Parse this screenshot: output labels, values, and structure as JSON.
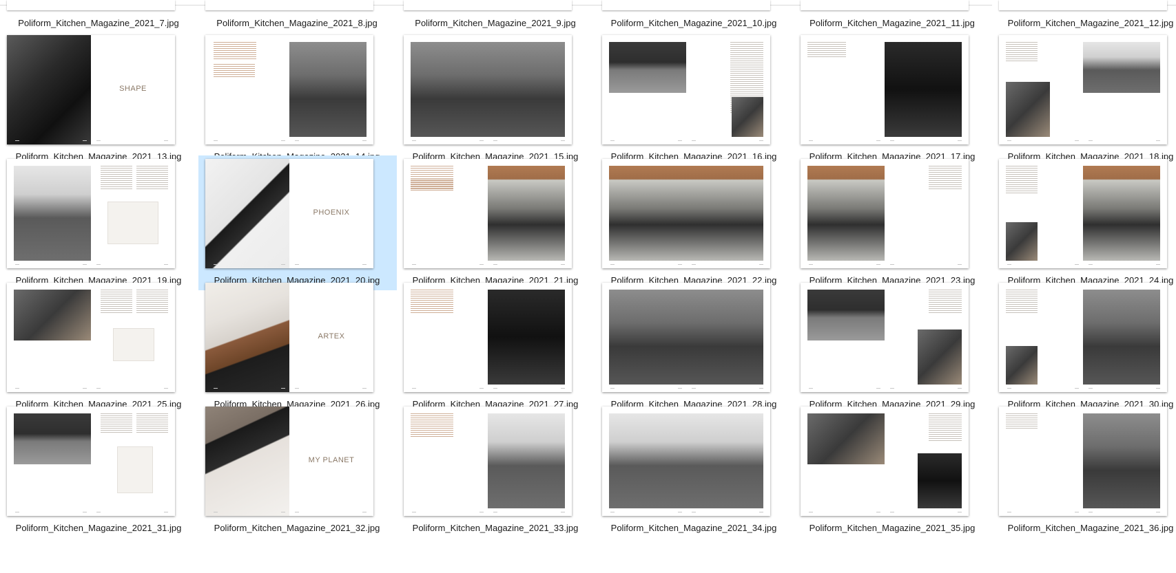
{
  "previous_row": [
    "Poliform_Kitchen_Magazine_2021_7.jpg",
    "Poliform_Kitchen_Magazine_2021_8.jpg",
    "Poliform_Kitchen_Magazine_2021_9.jpg",
    "Poliform_Kitchen_Magazine_2021_10.jpg",
    "Poliform_Kitchen_Magazine_2021_11.jpg",
    "Poliform_Kitchen_Magazine_2021_12.jpg"
  ],
  "files": [
    {
      "name": "Poliform_Kitchen_Magazine_2021_13.jpg",
      "cover_word": "SHAPE",
      "selected": false
    },
    {
      "name": "Poliform_Kitchen_Magazine_2021_14.jpg",
      "cover_word": "",
      "selected": false
    },
    {
      "name": "Poliform_Kitchen_Magazine_2021_15.jpg",
      "cover_word": "",
      "selected": false
    },
    {
      "name": "Poliform_Kitchen_Magazine_2021_16.jpg",
      "cover_word": "",
      "selected": false
    },
    {
      "name": "Poliform_Kitchen_Magazine_2021_17.jpg",
      "cover_word": "",
      "selected": false
    },
    {
      "name": "Poliform_Kitchen_Magazine_2021_18.jpg",
      "cover_word": "",
      "selected": false
    },
    {
      "name": "Poliform_Kitchen_Magazine_2021_19.jpg",
      "cover_word": "",
      "selected": false
    },
    {
      "name": "Poliform_Kitchen_Magazine_2021_20.jpg",
      "cover_word": "PHOENIX",
      "selected": true
    },
    {
      "name": "Poliform_Kitchen_Magazine_2021_21.jpg",
      "cover_word": "",
      "selected": false
    },
    {
      "name": "Poliform_Kitchen_Magazine_2021_22.jpg",
      "cover_word": "",
      "selected": false
    },
    {
      "name": "Poliform_Kitchen_Magazine_2021_23.jpg",
      "cover_word": "",
      "selected": false
    },
    {
      "name": "Poliform_Kitchen_Magazine_2021_24.jpg",
      "cover_word": "",
      "selected": false
    },
    {
      "name": "Poliform_Kitchen_Magazine_2021_25.jpg",
      "cover_word": "",
      "selected": false
    },
    {
      "name": "Poliform_Kitchen_Magazine_2021_26.jpg",
      "cover_word": "ARTEX",
      "selected": false
    },
    {
      "name": "Poliform_Kitchen_Magazine_2021_27.jpg",
      "cover_word": "",
      "selected": false
    },
    {
      "name": "Poliform_Kitchen_Magazine_2021_28.jpg",
      "cover_word": "",
      "selected": false
    },
    {
      "name": "Poliform_Kitchen_Magazine_2021_29.jpg",
      "cover_word": "",
      "selected": false
    },
    {
      "name": "Poliform_Kitchen_Magazine_2021_30.jpg",
      "cover_word": "",
      "selected": false
    },
    {
      "name": "Poliform_Kitchen_Magazine_2021_31.jpg",
      "cover_word": "",
      "selected": false
    },
    {
      "name": "Poliform_Kitchen_Magazine_2021_32.jpg",
      "cover_word": "MY PLANET",
      "selected": false
    },
    {
      "name": "Poliform_Kitchen_Magazine_2021_33.jpg",
      "cover_word": "",
      "selected": false
    },
    {
      "name": "Poliform_Kitchen_Magazine_2021_34.jpg",
      "cover_word": "",
      "selected": false
    },
    {
      "name": "Poliform_Kitchen_Magazine_2021_35.jpg",
      "cover_word": "",
      "selected": false
    },
    {
      "name": "Poliform_Kitchen_Magazine_2021_36.jpg",
      "cover_word": "",
      "selected": false
    }
  ],
  "colors": {
    "selection": "#cce8ff",
    "label_text": "#1a1a1a",
    "cover_word": "#8a7866"
  }
}
